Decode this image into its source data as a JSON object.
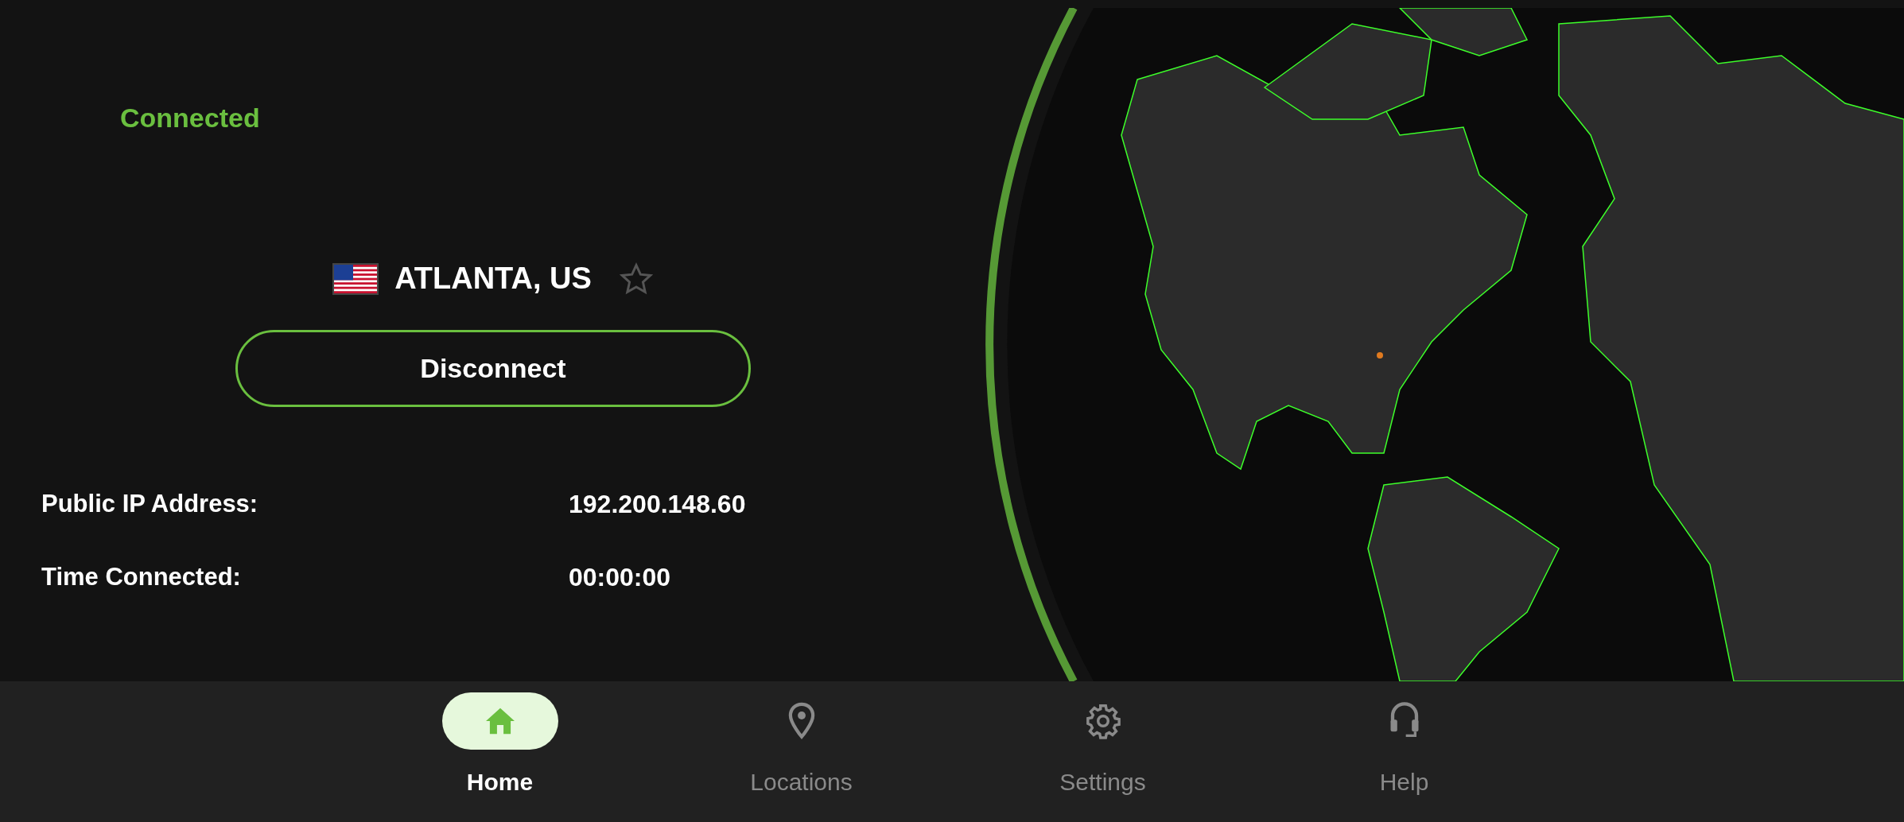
{
  "status": "Connected",
  "location": {
    "name": "ATLANTA, US",
    "favorite": false
  },
  "action_button": "Disconnect",
  "info_rows": [
    {
      "label": "Public IP Address:",
      "value": "192.200.148.60"
    },
    {
      "label": "Time Connected:",
      "value": "00:00:00"
    }
  ],
  "nav": [
    {
      "kind": "home",
      "label": "Home",
      "selected": true
    },
    {
      "kind": "pin",
      "label": "Locations",
      "selected": false
    },
    {
      "kind": "gear",
      "label": "Settings",
      "selected": false
    },
    {
      "kind": "headset",
      "label": "Help",
      "selected": false
    }
  ]
}
